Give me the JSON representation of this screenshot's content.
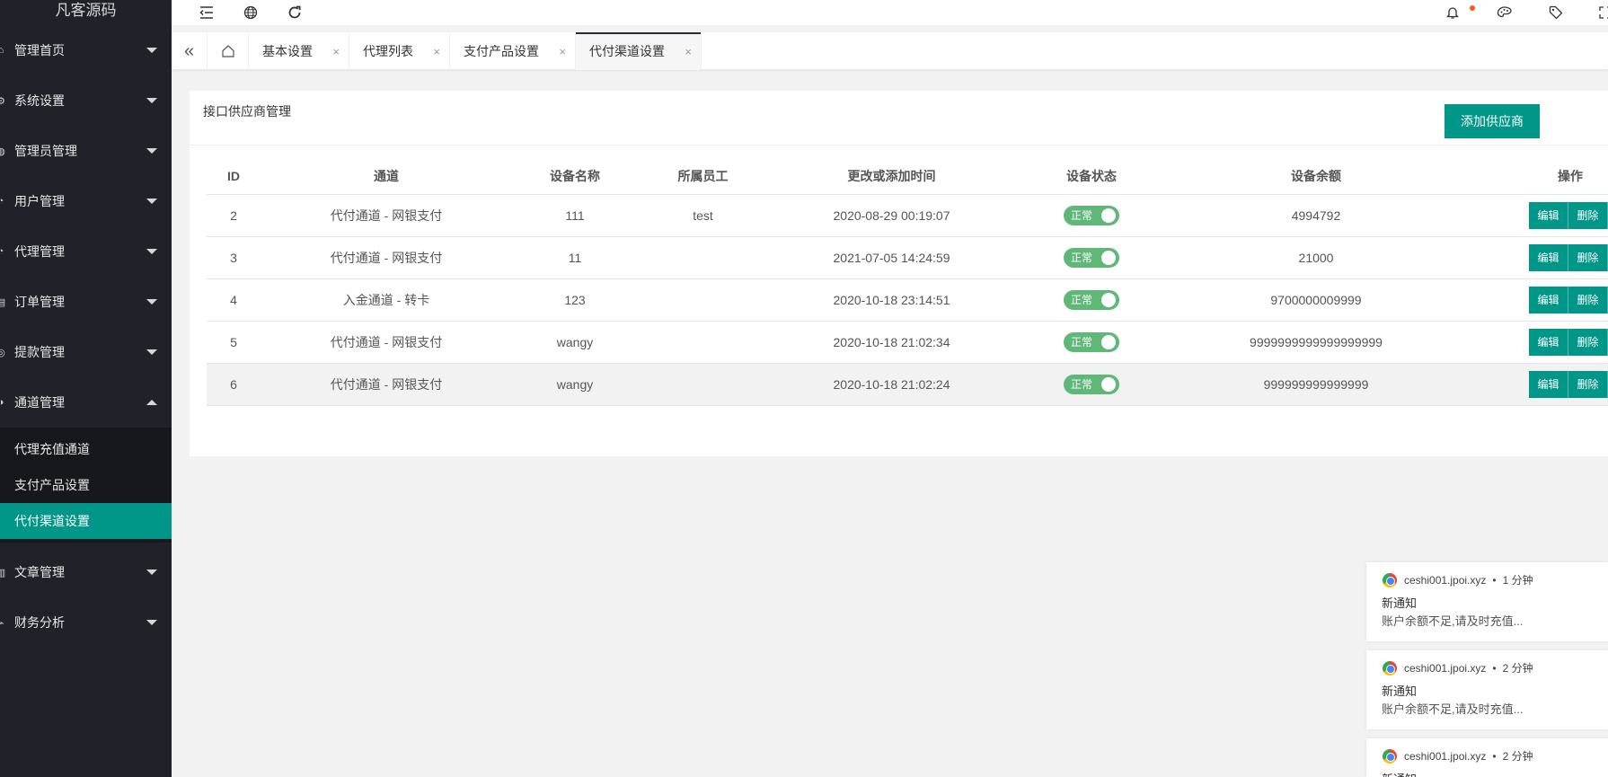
{
  "sidebar": {
    "logo": "凡客源码",
    "menu": [
      {
        "label": "管理首页"
      },
      {
        "label": "系统设置"
      },
      {
        "label": "管理员管理"
      },
      {
        "label": "用户管理"
      },
      {
        "label": "代理管理"
      },
      {
        "label": "订单管理"
      },
      {
        "label": "提款管理"
      },
      {
        "label": "通道管理"
      }
    ],
    "submenu": [
      {
        "label": "代理充值通道"
      },
      {
        "label": "支付产品设置"
      },
      {
        "label": "代付渠道设置"
      }
    ],
    "menu_after": [
      {
        "label": "文章管理"
      },
      {
        "label": "财务分析"
      }
    ]
  },
  "tabs": [
    {
      "label": "基本设置",
      "close": "×"
    },
    {
      "label": "代理列表",
      "close": "×"
    },
    {
      "label": "支付产品设置",
      "close": "×"
    },
    {
      "label": "代付渠道设置",
      "close": "×"
    }
  ],
  "page": {
    "title": "接口供应商管理",
    "add_button": "添加供应商"
  },
  "table": {
    "columns": [
      "ID",
      "通道",
      "设备名称",
      "所属员工",
      "更改或添加时间",
      "设备状态",
      "设备余额",
      "操作"
    ],
    "rows": [
      {
        "id": "2",
        "channel": "代付通道 - 网银支付",
        "device": "111",
        "staff": "test",
        "time": "2020-08-29 00:19:07",
        "status": "正常",
        "balance": "4994792"
      },
      {
        "id": "3",
        "channel": "代付通道 - 网银支付",
        "device": "11",
        "staff": "",
        "time": "2021-07-05 14:24:59",
        "status": "正常",
        "balance": "21000"
      },
      {
        "id": "4",
        "channel": "入金通道 - 转卡",
        "device": "123",
        "staff": "",
        "time": "2020-10-18 23:14:51",
        "status": "正常",
        "balance": "9700000009999"
      },
      {
        "id": "5",
        "channel": "代付通道 - 网银支付",
        "device": "wangy",
        "staff": "",
        "time": "2020-10-18 21:02:34",
        "status": "正常",
        "balance": "9999999999999999999"
      },
      {
        "id": "6",
        "channel": "代付通道 - 网银支付",
        "device": "wangy",
        "staff": "",
        "time": "2020-10-18 21:02:24",
        "status": "正常",
        "balance": "999999999999999"
      }
    ],
    "edit_label": "编辑",
    "delete_label": "删除"
  },
  "notifications": [
    {
      "source": "ceshi001.jpoi.xyz",
      "time": "1 分钟",
      "title": "新通知",
      "body": "账户余额不足,请及时充值..."
    },
    {
      "source": "ceshi001.jpoi.xyz",
      "time": "2 分钟",
      "title": "新通知",
      "body": "账户余额不足,请及时充值..."
    },
    {
      "source": "ceshi001.jpoi.xyz",
      "time": "2 分钟",
      "title": "新通知",
      "body": ""
    }
  ],
  "colors": {
    "sidebar_bg": "#20222a",
    "accent": "#009688",
    "switch_on": "#5fb878",
    "notify_dot": "#ff5722"
  },
  "icons": {
    "header": [
      "collapse-menu-icon",
      "globe-icon",
      "refresh-icon",
      "bell-icon",
      "palette-icon",
      "tag-icon",
      "fullscreen-icon"
    ],
    "tabbar": [
      "double-chevron-left-icon",
      "home-icon"
    ]
  }
}
